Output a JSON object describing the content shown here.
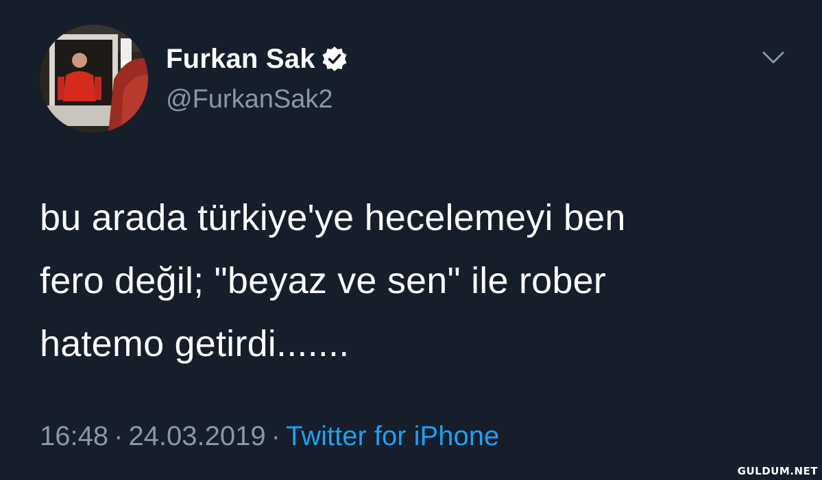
{
  "user": {
    "display_name": "Furkan Sak",
    "handle": "@FurkanSak2",
    "verified": true,
    "avatar_icon": "profile-photo"
  },
  "tweet": {
    "lines": [
      "bu arada türkiye'ye hecelemeyi ben",
      "fero değil; \"beyaz ve sen\" ile rober",
      "hatemo getirdi......."
    ]
  },
  "meta": {
    "time": "16:48",
    "date": "24.03.2019",
    "separator": "·",
    "source": "Twitter for iPhone"
  },
  "menu_icon": "chevron-down-icon",
  "watermark": "GULDUM.NET",
  "colors": {
    "background": "#161d2b",
    "text": "#ffffff",
    "secondary": "#8899a6",
    "link": "#1da1f2"
  }
}
